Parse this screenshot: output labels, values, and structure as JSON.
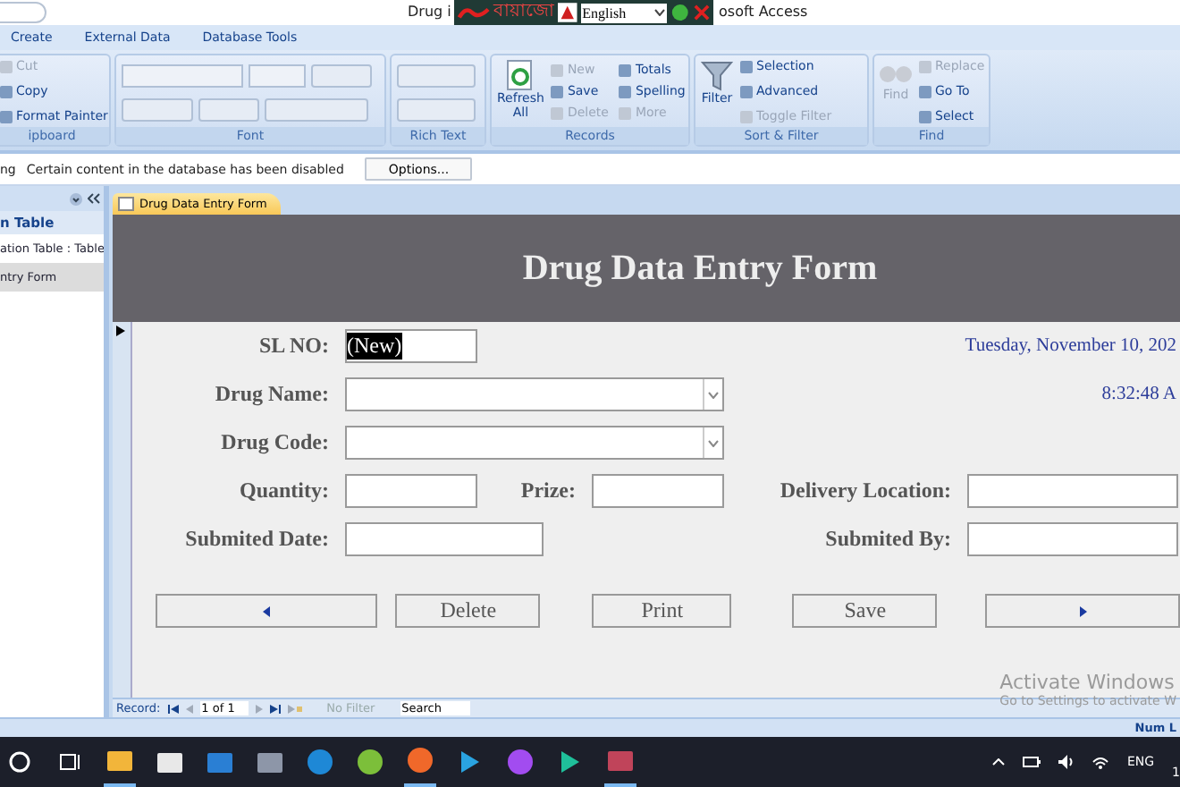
{
  "window": {
    "title_left": "Drug i",
    "title_right": "osoft Access"
  },
  "language_bar": {
    "script_text": "বায়াজো",
    "language": "English"
  },
  "ribbon_tabs": [
    {
      "label": "Create",
      "selected": false
    },
    {
      "label": "External Data",
      "selected": false
    },
    {
      "label": "Database Tools",
      "selected": false
    }
  ],
  "ribbon_groups": [
    {
      "label": "ipboard",
      "kind": "clipboard",
      "items": [
        {
          "label": "Cut",
          "disabled": true
        },
        {
          "label": "Copy",
          "disabled": false
        },
        {
          "label": "Format Painter",
          "disabled": false
        }
      ]
    },
    {
      "label": "Font",
      "kind": "font"
    },
    {
      "label": "Rich Text",
      "kind": "richtext"
    },
    {
      "label": "Records",
      "kind": "records",
      "big": {
        "label": "Refresh",
        "label2": "All",
        "disabled": false
      },
      "items": [
        {
          "label": "New",
          "disabled": true
        },
        {
          "label": "Save",
          "disabled": false
        },
        {
          "label": "Delete",
          "disabled": true
        },
        {
          "label": "Totals",
          "disabled": false
        },
        {
          "label": "Spelling",
          "disabled": false
        },
        {
          "label": "More",
          "disabled": true
        }
      ]
    },
    {
      "label": "Sort & Filter",
      "kind": "sort",
      "big": {
        "label": "Filter",
        "disabled": false
      },
      "items": [
        {
          "label": "Selection",
          "disabled": false
        },
        {
          "label": "Advanced",
          "disabled": false
        },
        {
          "label": "Toggle Filter",
          "disabled": true
        }
      ]
    },
    {
      "label": "Find",
      "kind": "find",
      "big": {
        "label": "Find",
        "disabled": true
      },
      "items": [
        {
          "label": "Replace",
          "disabled": true
        },
        {
          "label": "Go To",
          "disabled": false
        },
        {
          "label": "Select",
          "disabled": false
        }
      ]
    }
  ],
  "message_bar": {
    "label": "ng",
    "message": "Certain content in the database has been disabled",
    "button": "Options..."
  },
  "nav_pane": {
    "header": "n Table",
    "items": [
      {
        "label": "ation Table : Table",
        "selected": false
      },
      {
        "label": "ntry Form",
        "selected": true
      }
    ]
  },
  "document_tab": {
    "label": "Drug Data Entry Form"
  },
  "form": {
    "title": "Drug Data Entry Form",
    "date": "Tuesday, November 10, 202",
    "time": "8:32:48 A",
    "sl_no": {
      "label": "SL NO:",
      "value": "(New)"
    },
    "drug_name": {
      "label": "Drug Name:"
    },
    "drug_code": {
      "label": "Drug Code:"
    },
    "quantity": {
      "label": "Quantity:"
    },
    "prize": {
      "label": "Prize:"
    },
    "delivery_location": {
      "label": "Delivery Location:"
    },
    "submited_date": {
      "label": "Submited Date:"
    },
    "submited_by": {
      "label": "Submited By:"
    },
    "buttons": [
      {
        "kind": "prev"
      },
      {
        "kind": "text",
        "label": "Delete"
      },
      {
        "kind": "text",
        "label": "Print"
      },
      {
        "kind": "text",
        "label": "Save"
      },
      {
        "kind": "next"
      }
    ]
  },
  "record_nav": {
    "label": "Record:",
    "position": "1 of 1",
    "filter": "No Filter",
    "search": "Search"
  },
  "watermark": {
    "line1": "Activate Windows",
    "line2": "Go to Settings to activate W"
  },
  "status_bar": {
    "text": "Num L"
  },
  "taskbar": {
    "apps": [
      {
        "kind": "search"
      },
      {
        "kind": "taskview"
      },
      {
        "kind": "folder",
        "selected": true
      },
      {
        "kind": "store",
        "selected": false
      },
      {
        "kind": "mail",
        "selected": false
      },
      {
        "kind": "camera",
        "selected": false
      },
      {
        "kind": "edge",
        "selected": false
      },
      {
        "kind": "green",
        "selected": false
      },
      {
        "kind": "firefox",
        "selected": true
      },
      {
        "kind": "share",
        "selected": false
      },
      {
        "kind": "messenger",
        "selected": false
      },
      {
        "kind": "arrow",
        "selected": false
      },
      {
        "kind": "access",
        "selected": true
      }
    ],
    "language": "ENG",
    "clock": "1"
  }
}
